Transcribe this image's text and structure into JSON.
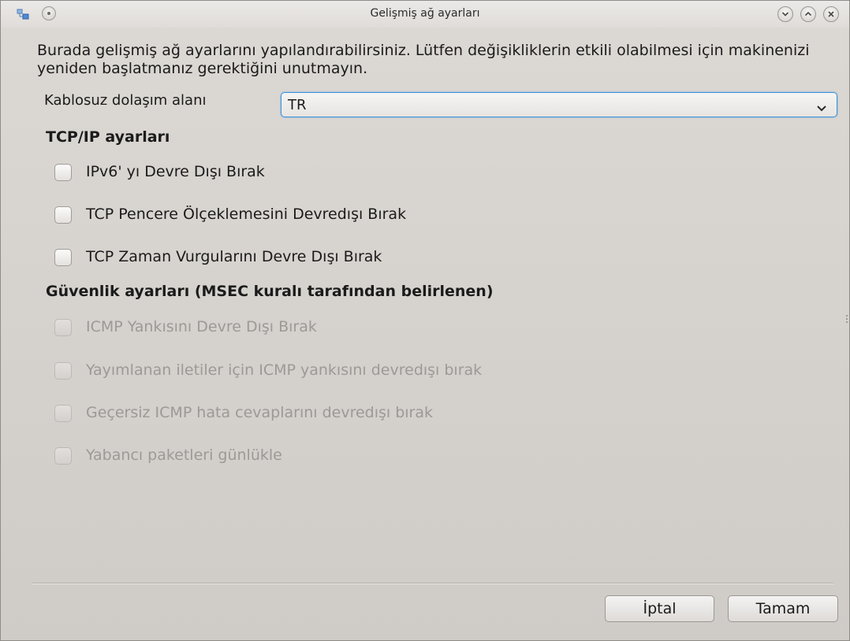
{
  "window": {
    "title": "Gelişmiş ağ ayarları"
  },
  "intro_text": "Burada gelişmiş ağ ayarlarını yapılandırabilirsiniz. Lütfen değişikliklerin etkili olabilmesi için makinenizi yeniden başlatmanız gerektiğini unutmayın.",
  "wireless_region": {
    "label": "Kablosuz dolaşım alanı",
    "selected": "TR"
  },
  "tcp_section": {
    "title": "TCP/IP ayarları",
    "options": [
      {
        "label": "IPv6' yı Devre Dışı Bırak",
        "checked": false,
        "enabled": true
      },
      {
        "label": "TCP Pencere Ölçeklemesini Devredışı Bırak",
        "checked": false,
        "enabled": true
      },
      {
        "label": "TCP Zaman Vurgularını Devre Dışı Bırak",
        "checked": false,
        "enabled": true
      }
    ]
  },
  "security_section": {
    "title": "Güvenlik ayarları (MSEC kuralı tarafından belirlenen)",
    "options": [
      {
        "label": "ICMP Yankısını Devre Dışı Bırak",
        "checked": false,
        "enabled": false
      },
      {
        "label": "Yayımlanan iletiler için ICMP yankısını devredışı bırak",
        "checked": false,
        "enabled": false
      },
      {
        "label": "Geçersiz ICMP hata cevaplarını devredışı bırak",
        "checked": false,
        "enabled": false
      },
      {
        "label": "Yabancı paketleri günlükle",
        "checked": false,
        "enabled": false
      }
    ]
  },
  "buttons": {
    "cancel": "İptal",
    "ok": "Tamam"
  },
  "colors": {
    "focus_border": "#3b8fd6",
    "disabled_text": "#9d9996"
  }
}
